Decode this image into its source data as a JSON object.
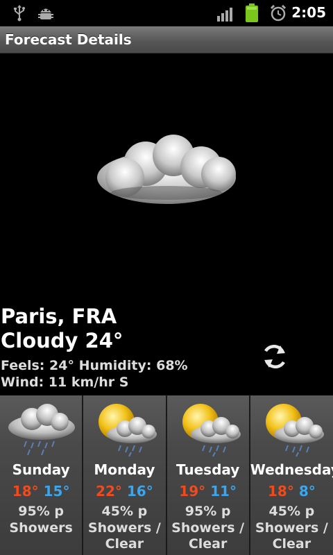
{
  "status_bar": {
    "time": "2:05",
    "icons": [
      "usb-icon",
      "android-debug-icon",
      "signal-icon",
      "battery-icon",
      "alarm-icon"
    ],
    "battery_color": "#7ac61c"
  },
  "title_bar": {
    "title": "Forecast Details"
  },
  "current": {
    "city": "Paris, FRA",
    "condition": "Cloudy 24°",
    "feels_humidity": "Feels: 24° Humidity: 68%",
    "wind": "Wind: 11 km/hr S",
    "icon": "cloud-icon"
  },
  "refresh": {
    "icon": "refresh-icon"
  },
  "forecast": [
    {
      "day": "Sunday",
      "high": "18°",
      "low": "15°",
      "precip": "95% p",
      "desc": "Showers",
      "icon": "rain-cloud-icon"
    },
    {
      "day": "Monday",
      "high": "22°",
      "low": "16°",
      "precip": "45% p",
      "desc": "Showers / Clear",
      "icon": "sun-rain-cloud-icon"
    },
    {
      "day": "Tuesday",
      "high": "19°",
      "low": "11°",
      "precip": "95% p",
      "desc": "Showers / Clear",
      "icon": "sun-rain-cloud-icon"
    },
    {
      "day": "Wednesday",
      "high": "18°",
      "low": "8°",
      "precip": "45% p",
      "desc": "Showers / Clear",
      "icon": "sun-rain-cloud-icon"
    }
  ],
  "colors": {
    "high": "#f04b1e",
    "low": "#3aa6ee"
  }
}
